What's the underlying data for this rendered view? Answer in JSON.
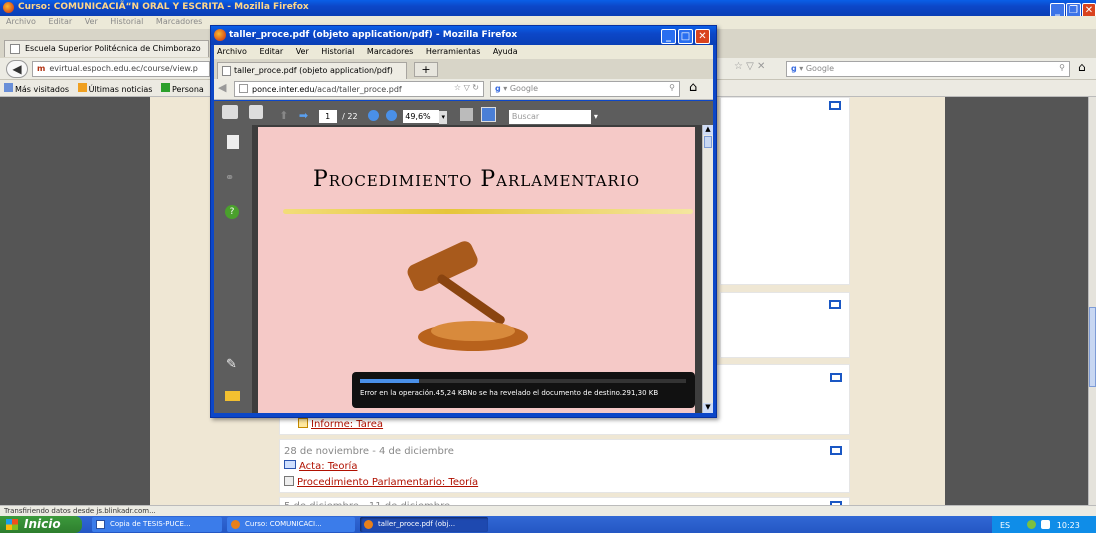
{
  "bg_window": {
    "title": "Curso: COMUNICACIÃ“N ORAL Y ESCRITA - Mozilla Firefox",
    "menu": [
      "Archivo",
      "Editar",
      "Ver",
      "Historial",
      "Marcadores"
    ],
    "tab": "Escuela Superior Politécnica de Chimborazo",
    "url_host": "evirtual.espoch.edu.ec",
    "url_path": "/course/view.p",
    "bookmarks": [
      "Más visitados",
      "Últimas noticias",
      "Persona"
    ],
    "search_placeholder": "Google",
    "status": "Transfiriendo datos desde js.blinkadr.com..."
  },
  "moodle": {
    "sections": [
      {
        "items": [
          {
            "label": "Informe: Tarea",
            "icon": "assignment-icon"
          }
        ]
      },
      {
        "date": "28 de noviembre - 4 de diciembre",
        "items": [
          {
            "label": "Acta: Teoría",
            "icon": "forum-icon"
          },
          {
            "label": "Procedimiento Parlamentario: Teoría",
            "icon": "document-icon"
          }
        ]
      },
      {
        "date": "5 de diciembre - 11 de diciembre",
        "items": []
      }
    ]
  },
  "fg_window": {
    "title": "taller_proce.pdf (objeto application/pdf) - Mozilla Firefox",
    "menu": [
      "Archivo",
      "Editar",
      "Ver",
      "Historial",
      "Marcadores",
      "Herramientas",
      "Ayuda"
    ],
    "tab": "taller_proce.pdf (objeto application/pdf)",
    "tab_add": "+",
    "url_host": "ponce.inter.edu",
    "url_path": "/acad/taller_proce.pdf",
    "search_placeholder": "Google",
    "pdf": {
      "page_current": "1",
      "page_total": "/ 22",
      "zoom": "49,6%",
      "search_placeholder": "Buscar",
      "title": "Procedimiento Parlamentario",
      "error": "Error en la operación.45,24 KBNo se ha revelado el documento de destino.291,30 KB",
      "progress": 0.18
    }
  },
  "taskbar": {
    "start": "Inicio",
    "items": [
      "Copia de TESIS-PUCE...",
      "Curso: COMUNICACI...",
      "taller_proce.pdf (obj..."
    ],
    "lang": "ES",
    "clock": "10:23"
  }
}
